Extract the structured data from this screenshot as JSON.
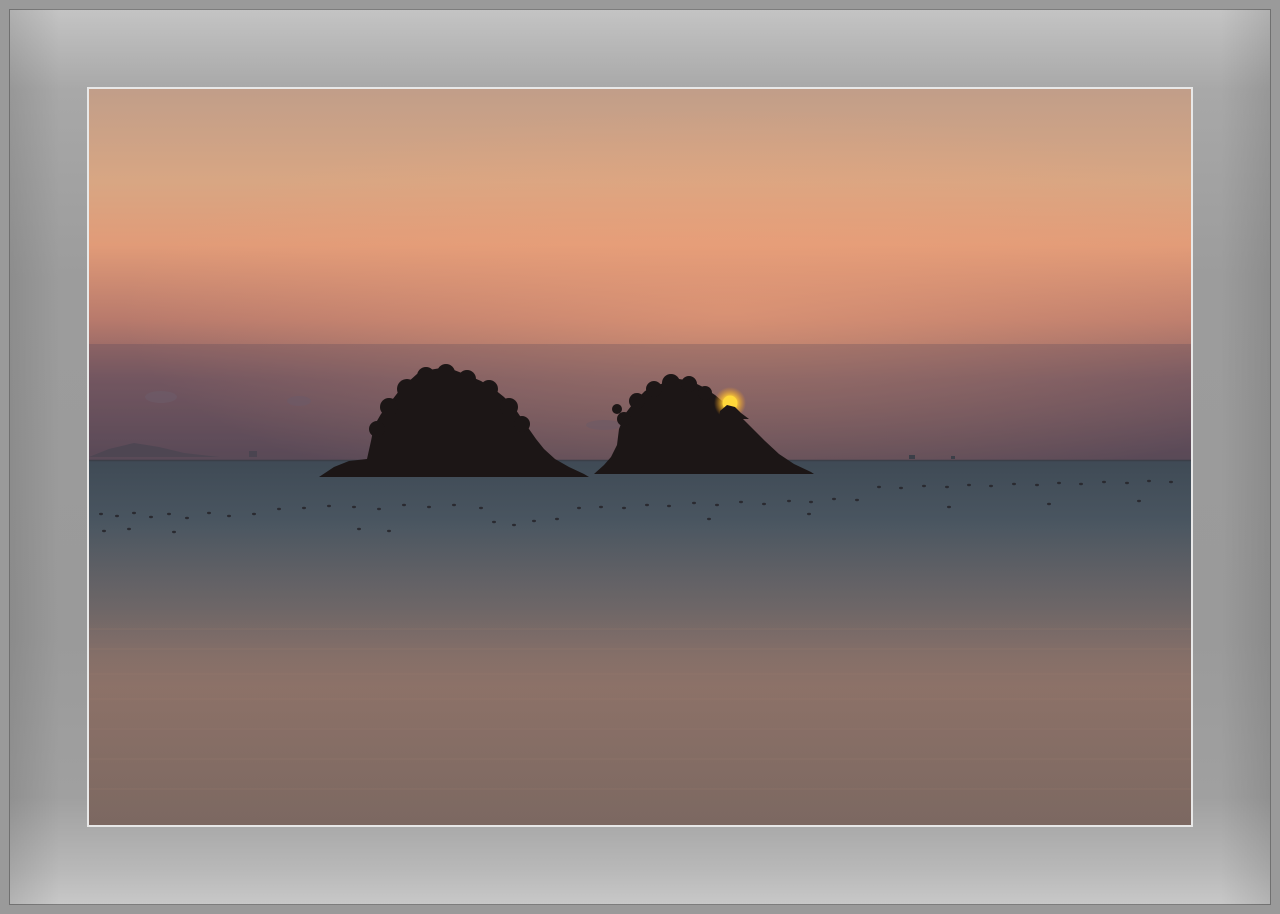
{
  "scene": {
    "subject": "sunset-over-sea-with-two-islands",
    "colors": {
      "sky_top": "#c6a58a",
      "sky_mid": "#d89a78",
      "sky_low": "#8d6468",
      "haze": "#5a4d5a",
      "sea_far": "#4e5b66",
      "sea_near": "#7d6a64",
      "sea_reflection": "#a27864",
      "island": "#1b1515",
      "sun": "#ffd23a",
      "frame": "#9a9a9a"
    }
  }
}
